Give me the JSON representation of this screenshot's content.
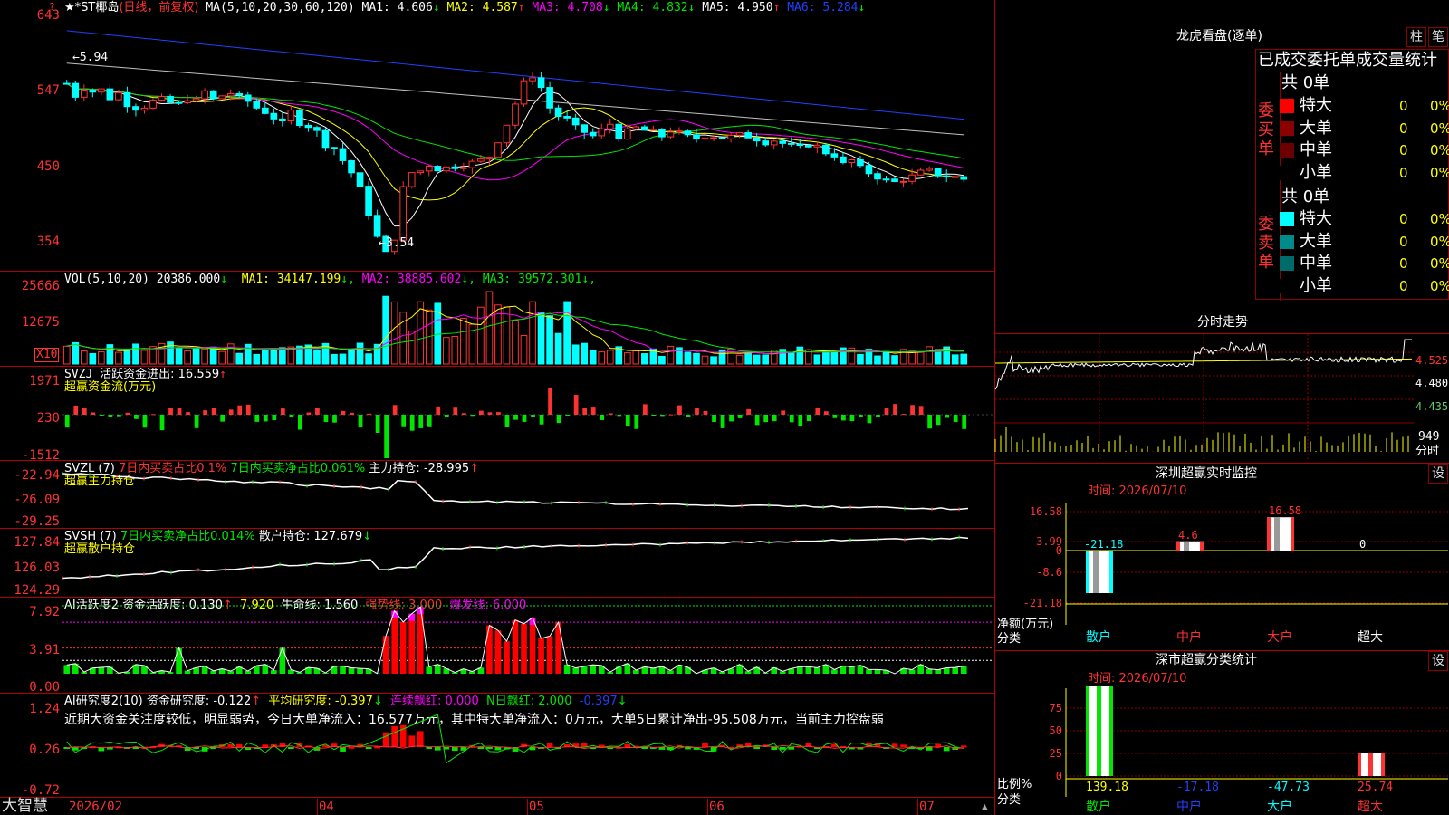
{
  "app": {
    "brand": "大智慧",
    "corner_icon": "?"
  },
  "kline": {
    "title": "★*ST椰岛",
    "period": "(日线，前复权)",
    "ma_label": "MA(5,10,20,30,60,120)",
    "ma": [
      {
        "name": "MA1:",
        "value": "4.606",
        "arrow": "↓",
        "color": "#ffffff"
      },
      {
        "name": "MA2:",
        "value": "4.587",
        "arrow": "↑",
        "color": "#ffff00"
      },
      {
        "name": "MA3:",
        "value": "4.708",
        "arrow": "↓",
        "color": "#ff00ff"
      },
      {
        "name": "MA4:",
        "value": "4.832",
        "arrow": "↓",
        "color": "#00e600"
      },
      {
        "name": "MA5:",
        "value": "4.950",
        "arrow": "↑",
        "color": "#ffffff"
      },
      {
        "name": "MA6:",
        "value": "5.284",
        "arrow": "↓",
        "color": "#2040ff"
      }
    ],
    "y_ticks": [
      "643",
      "547",
      "450",
      "354"
    ],
    "high_label": "←5.94",
    "low_label": "←3.54",
    "price_min": 3.4,
    "price_max": 6.55,
    "candles": [
      5.7,
      5.55,
      5.65,
      5.6,
      5.62,
      5.52,
      5.58,
      5.45,
      5.4,
      5.42,
      5.48,
      5.5,
      5.46,
      5.44,
      5.52,
      5.48,
      5.6,
      5.5,
      5.55,
      5.58,
      5.52,
      5.48,
      5.4,
      5.35,
      5.28,
      5.2,
      5.35,
      5.22,
      5.18,
      5.1,
      4.95,
      4.9,
      4.75,
      4.6,
      4.4,
      4.1,
      3.8,
      3.6,
      3.8,
      4.4,
      4.6,
      4.62,
      4.7,
      4.65,
      4.66,
      4.68,
      4.7,
      4.72,
      4.75,
      4.8,
      5.0,
      5.2,
      5.45,
      5.7,
      5.8,
      5.65,
      5.4,
      5.3,
      5.25,
      5.15,
      5.1,
      5.05,
      5.12,
      5.2,
      5.05,
      5.1,
      5.15,
      5.12,
      5.1,
      5.05,
      5.12,
      5.08,
      5.04,
      5.02,
      5.06,
      5.05,
      5.03,
      5.04,
      5.06,
      5.05,
      5.02,
      4.98,
      5.0,
      4.96,
      4.92,
      4.9,
      4.95,
      4.92,
      4.85,
      4.82,
      4.7,
      4.75,
      4.65,
      4.6,
      4.55,
      4.5,
      4.48,
      4.52,
      4.55,
      4.6,
      4.62,
      4.58,
      4.56,
      4.54,
      4.52
    ]
  },
  "vol": {
    "label": "VOL(5,10,20)",
    "value": "20386.000",
    "arrow": "↓",
    "ma": [
      {
        "name": "MA1:",
        "value": "34147.199",
        "arrow": "↓",
        "color": "#ffff00"
      },
      {
        "name": "MA2:",
        "value": "38885.602",
        "arrow": "↓",
        "color": "#ff00ff"
      },
      {
        "name": "MA3:",
        "value": "39572.301",
        "arrow": "↓",
        "color": "#00e600"
      }
    ],
    "y_ticks": [
      "25666",
      "12675"
    ],
    "unit": "X10"
  },
  "svzj": {
    "label": "SVZJ",
    "text": "活跃资金进出: 16.559",
    "arrow": "↑",
    "sub": "超赢资金流(万元)",
    "y_ticks": [
      "1971",
      "230",
      "-1512"
    ]
  },
  "svzl": {
    "label": "SVZL (7)",
    "t1": "7日内买卖占比0.1%",
    "t2": "7日内买卖净占比0.061%",
    "t3": "主力持仓: -28.995",
    "arrow": "↑",
    "sub": "超赢主力持仓",
    "y_ticks": [
      "-22.94",
      "-26.09",
      "-29.25"
    ]
  },
  "svsh": {
    "label": "SVSH (7)",
    "t1": "7日内买卖净占比0.014%",
    "t2": "散户持仓: 127.679",
    "arrow": "↓",
    "sub": "超赢散户持仓",
    "y_ticks": [
      "127.84",
      "126.03",
      "124.29"
    ]
  },
  "ai1": {
    "label": "AI活跃度2",
    "t1": "资金活跃度: 0.130",
    "a1": "↑",
    "t2": "7.920",
    "t3": "生命线: 1.560",
    "t4": "强势线: 3.000",
    "t5": "爆发线: 6.000",
    "y_ticks": [
      "7.92",
      "3.91",
      "0.00"
    ]
  },
  "ai2": {
    "label": "AI研究度2(10)",
    "t1": "资金研究度: -0.122",
    "a1": "↑",
    "t2": "平均研究度: -0.397",
    "a2": "↓",
    "t3": "连续飘红: 0.000",
    "t4": "N日飘红: 2.000",
    "t5": "-0.397",
    "a5": "↓",
    "comment": "近期大资金关注度较低，明显弱势，今日大单净流入：16.577万元，其中特大单净流入：0万元，大单5日累计净出-95.508万元，当前主力控盘弱",
    "y_ticks": [
      "1.24",
      "0.26",
      "-0.72"
    ]
  },
  "xaxis": [
    "2026/02",
    "04",
    "05",
    "06",
    "07"
  ],
  "lhb": {
    "title": "龙虎看盘(逐单)",
    "tab1": "柱",
    "tab2": "笔",
    "header": "已成交委托单成交量统计",
    "buy": {
      "side": "委买单",
      "total": "共 0单",
      "rows": [
        {
          "name": "特大",
          "n": "0",
          "p": "0%",
          "color": "#ff0000"
        },
        {
          "name": "大单",
          "n": "0",
          "p": "0%",
          "color": "#8b0000"
        },
        {
          "name": "中单",
          "n": "0",
          "p": "0%",
          "color": "#6b0000"
        },
        {
          "name": "小单",
          "n": "0",
          "p": "0%",
          "color": "#000000"
        }
      ]
    },
    "sell": {
      "side": "委卖单",
      "total": "共 0单",
      "rows": [
        {
          "name": "特大",
          "n": "0",
          "p": "0%",
          "color": "#00ffff"
        },
        {
          "name": "大单",
          "n": "0",
          "p": "0%",
          "color": "#008b8b"
        },
        {
          "name": "中单",
          "n": "0",
          "p": "0%",
          "color": "#006b6b"
        },
        {
          "name": "小单",
          "n": "0",
          "p": "0%",
          "color": "#000000"
        }
      ]
    }
  },
  "fenshi": {
    "title": "分时走势",
    "prices": [
      "4.525",
      "4.480",
      "4.435"
    ],
    "vol": "949",
    "vol_label": "分时"
  },
  "monitor": {
    "title": "深圳超赢实时监控",
    "set": "设",
    "time": "时间: 2026/07/10",
    "y_ticks": [
      "16.58",
      "3.99",
      "0",
      "-8.6",
      "-21.18"
    ],
    "ylabel": "净额(万元)",
    "xlabel": "分类",
    "cats": [
      "散户",
      "中户",
      "大户",
      "超大"
    ],
    "values": [
      -21.18,
      4.6,
      16.58,
      0
    ],
    "value_labels": [
      "-21.18",
      "4.6",
      "16.58",
      "0"
    ]
  },
  "classify": {
    "title": "深市超赢分类统计",
    "set": "设",
    "time": "时间: 2026/07/10",
    "y_ticks": [
      "75",
      "50",
      "25",
      "0"
    ],
    "ylabel": "比例%",
    "xlabel": "分类",
    "cats": [
      "散户",
      "中户",
      "大户",
      "超大"
    ],
    "values": [
      139.18,
      -17.18,
      -47.73,
      25.74
    ],
    "value_labels": [
      "139.18",
      "-17.18",
      "-47.73",
      "25.74"
    ]
  }
}
